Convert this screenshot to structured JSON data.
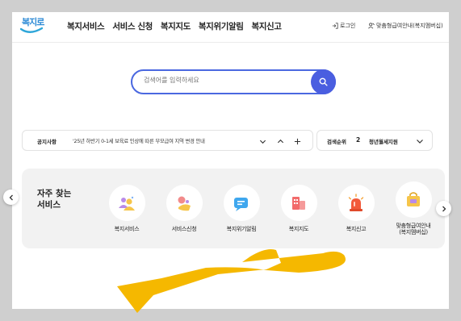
{
  "header": {
    "logo_text": "복지로",
    "nav": [
      "복지서비스",
      "서비스 신청",
      "복지지도",
      "복지위기알림",
      "복지신고"
    ],
    "login": "로그인",
    "custom_guide": "맞춤형급여안내(복지멤버십)"
  },
  "search": {
    "placeholder": "검색어를 입력하세요"
  },
  "notice": {
    "label": "공지사항",
    "text": "'25년 하반기 0-1세 보육료 인상에 따른 부모급여 지역 변경 안내"
  },
  "rank": {
    "label": "검색순위",
    "number": "2",
    "term": "청년월세지원"
  },
  "quick_menu": {
    "title": "자주 찾는 서비스",
    "items": [
      {
        "label": "복지서비스",
        "icon": "people-icon"
      },
      {
        "label": "서비스신청",
        "icon": "apply-icon"
      },
      {
        "label": "복지위기알림",
        "icon": "message-icon"
      },
      {
        "label": "복지지도",
        "icon": "map-icon"
      },
      {
        "label": "복지신고",
        "icon": "siren-icon"
      },
      {
        "label": "맞춤형급여안내\n(복지멤버십)",
        "icon": "membership-icon"
      }
    ]
  },
  "colors": {
    "accent": "#4a5ee0",
    "hand": "#f5b800",
    "quick_bg": "#f2f2f2"
  }
}
